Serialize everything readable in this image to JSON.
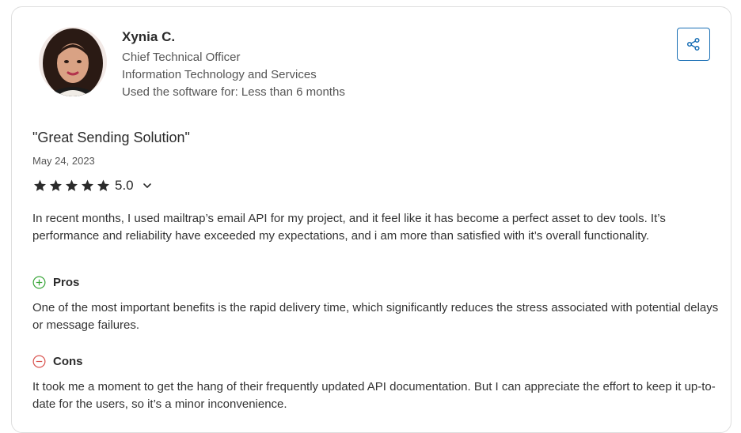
{
  "reviewer": {
    "name": "Xynia C.",
    "role": "Chief Technical Officer",
    "industry": "Information Technology and Services",
    "usage": "Used the software for: Less than 6 months"
  },
  "review": {
    "title": "\"Great Sending Solution\"",
    "date": "May 24, 2023",
    "rating": 5.0,
    "rating_text": "5.0",
    "summary": "In recent months, I used mailtrap’s email API for my project, and it feel like it has become a perfect asset to dev tools. It’s performance and reliability have exceeded my expectations, and i am more than satisfied with it’s overall functionality.",
    "pros_label": "Pros",
    "pros": "One of the most important benefits is the rapid delivery time, which significantly reduces the stress associated with potential delays or message failures.",
    "cons_label": "Cons",
    "cons": "It took me a moment to get the hang of their frequently updated API documentation. But I can appreciate the effort to keep it up-to-date for the users, so it’s a minor inconvenience."
  },
  "colors": {
    "accent": "#1a6fb5",
    "star": "#2b2b2b",
    "pros": "#3aa63a",
    "cons": "#d9534f"
  },
  "icons": {
    "share": "share-icon",
    "star": "star-icon",
    "chevron": "chevron-down-icon",
    "pros": "plus-circle-icon",
    "cons": "minus-circle-icon"
  }
}
